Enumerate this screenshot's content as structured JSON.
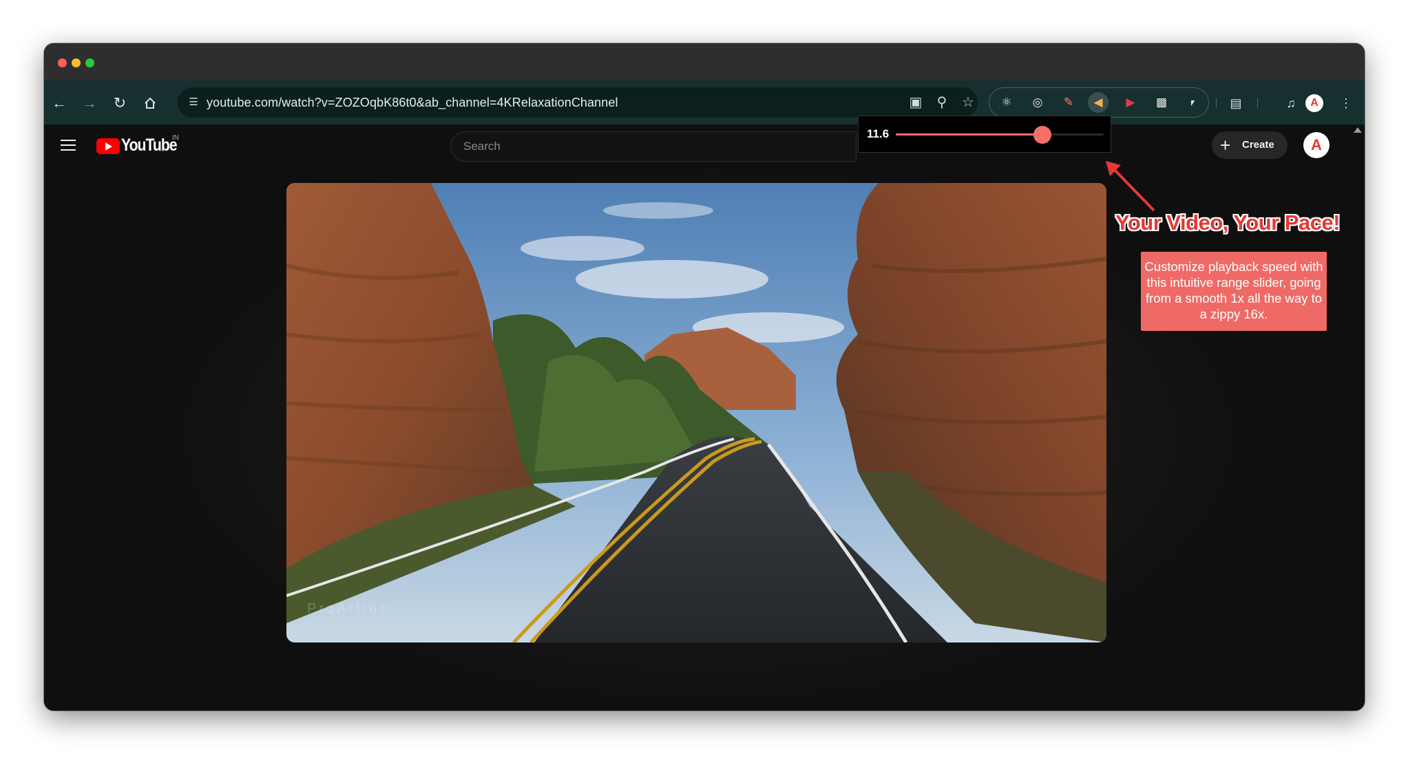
{
  "browser": {
    "url": "youtube.com/watch?v=ZOZOqbK86t0&ab_channel=4KRelaxationChannel",
    "nav": {
      "back_icon": "arrow-left-icon",
      "forward_icon": "arrow-right-icon",
      "reload_icon": "reload-icon",
      "home_icon": "home-icon"
    },
    "omnibox_icons": [
      "install-app-icon",
      "zoom-icon",
      "bookmark-star-icon"
    ],
    "extensions": [
      "react-devtools-icon",
      "target-icon",
      "pen-icon",
      "speed-extension-icon",
      "record-icon",
      "screenshot-icon",
      "puzzle-icon"
    ],
    "right_icons": [
      "reading-list-icon",
      "media-control-icon",
      "profile-avatar",
      "more-menu-icon"
    ],
    "profile_letter": "A"
  },
  "youtube": {
    "logo_text": "YouTube",
    "country_code": "IN",
    "search_placeholder": "Search",
    "create_label": "Create",
    "avatar_letter": "A"
  },
  "speed_control": {
    "value_label": "11.6",
    "value": 11.6,
    "min": 1,
    "max": 16,
    "accent_color": "#f47068"
  },
  "video": {
    "watermark": "ProArtInc"
  },
  "callout": {
    "headline": "Your Video, Your Pace!",
    "description": "Customize playback speed with this intuitive range slider, going from a smooth 1x all the way to a zippy 16x.",
    "color": "#ef6a66"
  }
}
